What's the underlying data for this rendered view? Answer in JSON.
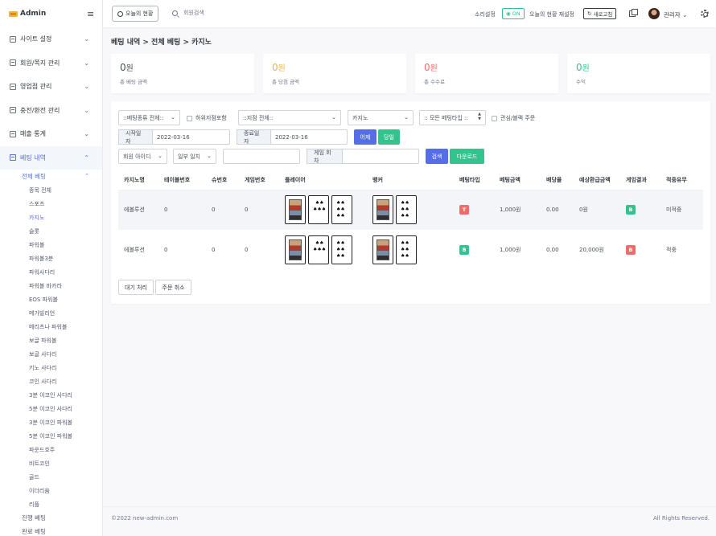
{
  "sidebar": {
    "logo": "Admin",
    "toggle_icon": "hamburger-icon",
    "menu": [
      {
        "label": "사이트 설정"
      },
      {
        "label": "회원/쪽지 관리"
      },
      {
        "label": "영업점 관리"
      },
      {
        "label": "충전/환전 관리"
      },
      {
        "label": "매출 통계"
      },
      {
        "label": "베팅 내역"
      }
    ],
    "sub_head": "전체 베팅",
    "sub_items": [
      "종목 전체",
      "스포츠",
      "카지노",
      "슬롯",
      "파워볼",
      "파워볼3분",
      "파워사다리",
      "파워볼 바카라",
      "EOS 파워볼",
      "메가빌리언",
      "메리츠나 파워볼",
      "보글 파워볼",
      "보글 사다리",
      "키노 사다리",
      "코인 사다리",
      "3분 이코인 사다리",
      "5분 이코인 사다리",
      "3분 이코인 파워볼",
      "5분 이코인 파워볼",
      "파운드호주",
      "비트코인",
      "골드",
      "이더리움",
      "리플"
    ],
    "sub_tops": [
      "진행 베팅",
      "완료 베팅"
    ]
  },
  "topbar": {
    "today_btn": "오늘의 현황",
    "search_placeholder": "회원검색",
    "sound_label": "소리설정",
    "sound_state": "ON",
    "reset_label": "오늘의 현황 재설정",
    "refresh_btn": "새로고침",
    "admin": "관리자"
  },
  "page": {
    "title": "베팅 내역 > 전체 베팅 > 카지노"
  },
  "stats": [
    {
      "value": "0",
      "unit": "원",
      "label": "총 베팅 금액"
    },
    {
      "value": "0",
      "unit": "원",
      "label": "총 당첨 금액"
    },
    {
      "value": "0",
      "unit": "원",
      "label": "총 수수료"
    },
    {
      "value": "0",
      "unit": "원",
      "label": "수익"
    }
  ],
  "filters": {
    "bet_kind": "::베팅종류 전체::",
    "include_sub": "하위지점포함",
    "branch": "::지점 전체::",
    "game": "카지노",
    "bet_type": ":: 모든 베팅타입 ::",
    "interest": "관심/블랙 주문",
    "start_label": "시작일자",
    "start_value": "2022-03-16",
    "end_label": "종료일자",
    "end_value": "2022-03-16",
    "yesterday": "어제",
    "today": "당일",
    "member_select": "회원 아이디",
    "match_select": "일부 일치",
    "member_input": "",
    "round_label": "게임 회차",
    "round_value": "",
    "search_btn": "검색",
    "download_btn": "다운로드"
  },
  "table": {
    "headers": [
      "카지노명",
      "테이블번호",
      "슈번호",
      "게임번호",
      "플레이어",
      "뱅커",
      "베팅타입",
      "베팅금액",
      "배당율",
      "예상환급금액",
      "게임결과",
      "적중유무"
    ],
    "rows": [
      {
        "casino": "에볼루션",
        "table_no": "0",
        "shoe_no": "0",
        "game_no": "0",
        "bet_type": "T",
        "amount": "1,000원",
        "odds": "0.00",
        "expected": "0원",
        "result": "B",
        "hit": "미적중"
      },
      {
        "casino": "에볼루션",
        "table_no": "0",
        "shoe_no": "0",
        "game_no": "0",
        "bet_type": "B",
        "amount": "1,000원",
        "odds": "0.00",
        "expected": "20,000원",
        "result": "B",
        "hit": "적중"
      }
    ]
  },
  "actions": {
    "wait": "대기 처리",
    "cancel": "주문 취소"
  },
  "footer": {
    "copyright": "©2022 new-admin.com",
    "rights": "All Rights Reserved."
  },
  "colors": {
    "primary": "#556ee6",
    "success": "#34c38f",
    "danger": "#f46a6a",
    "warning": "#f1b44c"
  }
}
